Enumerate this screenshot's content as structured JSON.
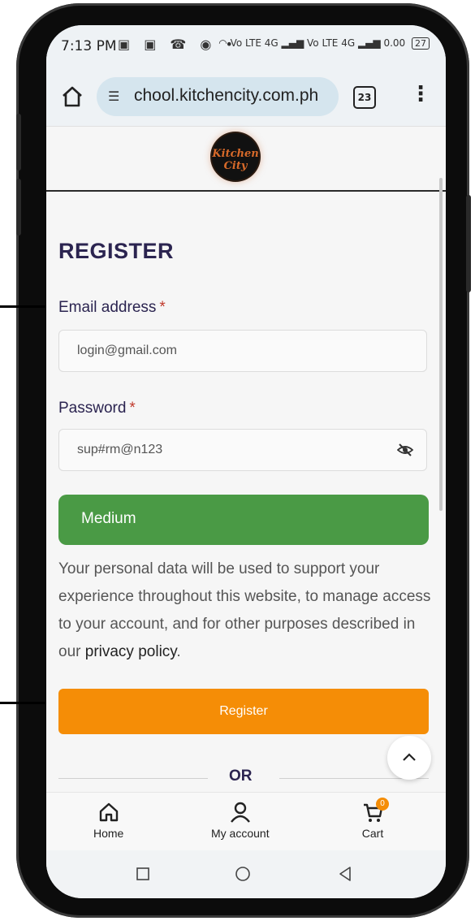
{
  "status_bar": {
    "time": "7:13 PM",
    "notifications": "▣ ▣ ☎ ◉ •",
    "network": "Vo LTE 4G ▂▄▆ Vo LTE 4G ▂▄▆ 0.00",
    "battery": "27"
  },
  "browser": {
    "url": "chool.kitchencity.com.ph",
    "tab_count": "23"
  },
  "site": {
    "logo_text": "Kitchen City"
  },
  "form": {
    "heading": "REGISTER",
    "email_label": "Email address",
    "email_value": "login@gmail.com",
    "password_label": "Password",
    "password_value": "sup#rm@n123",
    "required_mark": "*",
    "strength_label": "Medium",
    "privacy_text": "Your personal data will be used to support your experience throughout this website, to manage access to your account, and for other purposes described in our ",
    "privacy_link": "privacy policy",
    "privacy_end": ".",
    "register_label": "Register",
    "or_text": "OR"
  },
  "bottom_nav": {
    "home": "Home",
    "account": "My account",
    "cart": "Cart",
    "cart_count": "0"
  },
  "colors": {
    "heading": "#2b2450",
    "strength_medium": "#4a9a45",
    "register_button": "#f58d06"
  }
}
